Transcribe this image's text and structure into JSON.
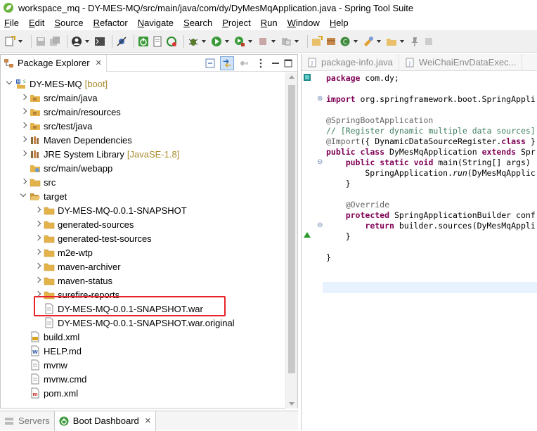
{
  "window": {
    "title": "workspace_mq - DY-MES-MQ/src/main/java/com/dy/DyMesMqApplication.java - Spring Tool Suite"
  },
  "menubar": [
    {
      "label": "File",
      "key": "F",
      "rest": "ile"
    },
    {
      "label": "Edit",
      "key": "E",
      "rest": "dit"
    },
    {
      "label": "Source",
      "key": "S",
      "rest": "ource"
    },
    {
      "label": "Refactor",
      "key": "R",
      "pre": "Refac",
      "rest": "tor",
      "keyIdx": "t"
    },
    {
      "label": "Navigate",
      "key": "N",
      "rest": "avigate"
    },
    {
      "label": "Search",
      "key": "S",
      "pre": "Se",
      "rest": "arch"
    },
    {
      "label": "Project",
      "key": "P",
      "rest": "roject"
    },
    {
      "label": "Run",
      "key": "R",
      "rest": "un"
    },
    {
      "label": "Window",
      "key": "W",
      "rest": "indow"
    },
    {
      "label": "Help",
      "key": "H",
      "rest": "elp"
    }
  ],
  "explorer": {
    "tab_label": "Package Explorer",
    "tree": [
      {
        "label": "DY-MES-MQ",
        "decoration": "[boot]",
        "depth": 0,
        "twisty": "open",
        "icon": "project-icon"
      },
      {
        "label": "src/main/java",
        "depth": 1,
        "twisty": "closed",
        "icon": "source-folder-icon"
      },
      {
        "label": "src/main/resources",
        "depth": 1,
        "twisty": "closed",
        "icon": "source-folder-icon"
      },
      {
        "label": "src/test/java",
        "depth": 1,
        "twisty": "closed",
        "icon": "source-folder-icon"
      },
      {
        "label": "Maven Dependencies",
        "depth": 1,
        "twisty": "closed",
        "icon": "library-icon"
      },
      {
        "label": "JRE System Library",
        "decoration": "[JavaSE-1.8]",
        "depth": 1,
        "twisty": "closed",
        "icon": "library-icon"
      },
      {
        "label": "src/main/webapp",
        "depth": 1,
        "twisty": "none",
        "icon": "webapp-folder-icon"
      },
      {
        "label": "src",
        "depth": 1,
        "twisty": "closed",
        "icon": "folder-icon"
      },
      {
        "label": "target",
        "depth": 1,
        "twisty": "open",
        "icon": "folder-open-icon"
      },
      {
        "label": "DY-MES-MQ-0.0.1-SNAPSHOT",
        "depth": 2,
        "twisty": "closed",
        "icon": "folder-icon"
      },
      {
        "label": "generated-sources",
        "depth": 2,
        "twisty": "closed",
        "icon": "folder-icon"
      },
      {
        "label": "generated-test-sources",
        "depth": 2,
        "twisty": "closed",
        "icon": "folder-icon"
      },
      {
        "label": "m2e-wtp",
        "depth": 2,
        "twisty": "closed",
        "icon": "folder-icon"
      },
      {
        "label": "maven-archiver",
        "depth": 2,
        "twisty": "closed",
        "icon": "folder-icon"
      },
      {
        "label": "maven-status",
        "depth": 2,
        "twisty": "closed",
        "icon": "folder-icon"
      },
      {
        "label": "surefire-reports",
        "depth": 2,
        "twisty": "closed",
        "icon": "folder-icon"
      },
      {
        "label": "DY-MES-MQ-0.0.1-SNAPSHOT.war",
        "depth": 2,
        "twisty": "none",
        "icon": "file-icon"
      },
      {
        "label": "DY-MES-MQ-0.0.1-SNAPSHOT.war.original",
        "depth": 2,
        "twisty": "none",
        "icon": "file-icon"
      },
      {
        "label": "build.xml",
        "depth": 1,
        "twisty": "none",
        "icon": "xml-file-icon"
      },
      {
        "label": "HELP.md",
        "depth": 1,
        "twisty": "none",
        "icon": "markdown-file-icon"
      },
      {
        "label": "mvnw",
        "depth": 1,
        "twisty": "none",
        "icon": "file-icon"
      },
      {
        "label": "mvnw.cmd",
        "depth": 1,
        "twisty": "none",
        "icon": "file-icon"
      },
      {
        "label": "pom.xml",
        "depth": 1,
        "twisty": "none",
        "icon": "pom-file-icon"
      }
    ]
  },
  "bottom_tabs": [
    {
      "label": "Servers",
      "active": false
    },
    {
      "label": "Boot Dashboard",
      "active": true
    }
  ],
  "editor": {
    "tabs": [
      {
        "label": "package-info.java"
      },
      {
        "label": "WeiChaiEnvDataExec..."
      }
    ],
    "lines": [
      [
        {
          "t": "package",
          "c": "kw"
        },
        {
          "t": " com.dy;"
        }
      ],
      [],
      [
        {
          "t": "import",
          "c": "kw"
        },
        {
          "t": " org.springframework.boot.SpringAppli"
        }
      ],
      [],
      [
        {
          "t": "@SpringBootApplication",
          "c": "ann"
        }
      ],
      [
        {
          "t": "// [Register dynamic multiple data sources]",
          "c": "cm"
        }
      ],
      [
        {
          "t": "@Import",
          "c": "ann"
        },
        {
          "t": "({ DynamicDataSourceRegister."
        },
        {
          "t": "class",
          "c": "kw"
        },
        {
          "t": " }"
        }
      ],
      [
        {
          "t": "public",
          "c": "kw"
        },
        {
          "t": " "
        },
        {
          "t": "class",
          "c": "kw"
        },
        {
          "t": " DyMesMqApplication "
        },
        {
          "t": "extends",
          "c": "kw"
        },
        {
          "t": " Spr"
        }
      ],
      [
        {
          "t": "    "
        },
        {
          "t": "public",
          "c": "kw"
        },
        {
          "t": " "
        },
        {
          "t": "static",
          "c": "kw"
        },
        {
          "t": " "
        },
        {
          "t": "void",
          "c": "kw"
        },
        {
          "t": " main(String[] args)"
        }
      ],
      [
        {
          "t": "        SpringApplication."
        },
        {
          "t": "run",
          "c": "it"
        },
        {
          "t": "(DyMesMqApplic"
        }
      ],
      [
        {
          "t": "    }"
        }
      ],
      [],
      [
        {
          "t": "    "
        },
        {
          "t": "@Override",
          "c": "ann"
        }
      ],
      [
        {
          "t": "    "
        },
        {
          "t": "protected",
          "c": "kw"
        },
        {
          "t": " SpringApplicationBuilder conf"
        }
      ],
      [
        {
          "t": "        "
        },
        {
          "t": "return",
          "c": "kw"
        },
        {
          "t": " builder.sources(DyMesMqAppli"
        }
      ],
      [
        {
          "t": "    }"
        }
      ],
      [],
      [
        {
          "t": "}"
        }
      ]
    ]
  },
  "colors": {
    "highlight_box": "#e8232a",
    "keyword": "#7f0055",
    "comment": "#3f7f5f",
    "annotation": "#646464",
    "decoration": "#a88b2c"
  }
}
